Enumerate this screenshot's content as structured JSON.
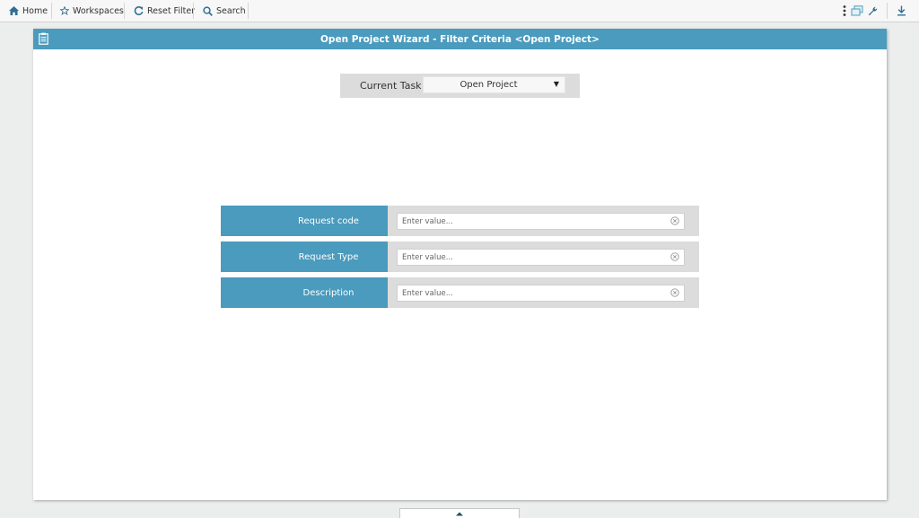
{
  "toolbar": {
    "home_label": "Home",
    "workspaces_label": "Workspaces",
    "reset_filter_label": "Reset Filter",
    "search_label": "Search"
  },
  "panel": {
    "title": "Open Project Wizard - Filter Criteria <Open Project>"
  },
  "current_task": {
    "label": "Current Task",
    "value": "Open Project"
  },
  "filters": [
    {
      "label": "Request code",
      "placeholder": "Enter value..."
    },
    {
      "label": "Request Type",
      "placeholder": "Enter value..."
    },
    {
      "label": "Description",
      "placeholder": "Enter value..."
    }
  ],
  "colors": {
    "accent": "#4a9bbd",
    "field_bg": "#dcdcdc",
    "page_bg": "#eceded"
  }
}
